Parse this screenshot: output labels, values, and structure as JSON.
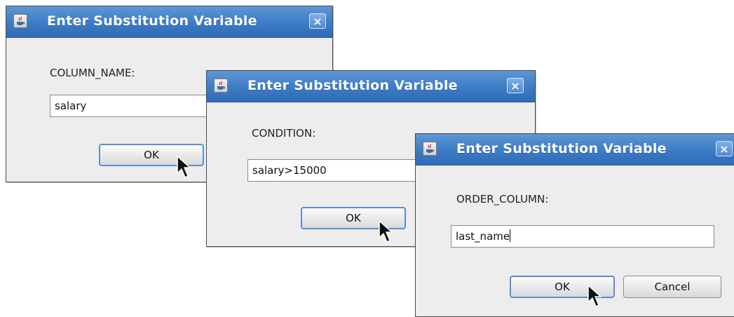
{
  "dialogs": [
    {
      "title": "Enter Substitution Variable",
      "field_label": "COLUMN_NAME:",
      "input_value": "salary",
      "ok_label": "OK"
    },
    {
      "title": "Enter Substitution Variable",
      "field_label": "CONDITION:",
      "input_value": "salary>15000",
      "ok_label": "OK"
    },
    {
      "title": "Enter Substitution Variable",
      "field_label": "ORDER_COLUMN:",
      "input_value": "last_name",
      "ok_label": "OK",
      "cancel_label": "Cancel"
    }
  ],
  "close_glyph": "×",
  "icons": {
    "app": "java-app-icon",
    "close": "close-icon",
    "pointer": "mouse-pointer-icon"
  },
  "colors": {
    "titlebar": "#3f7dc7",
    "dialog_background": "#ededed",
    "default_button_border": "#5b8fd0"
  }
}
